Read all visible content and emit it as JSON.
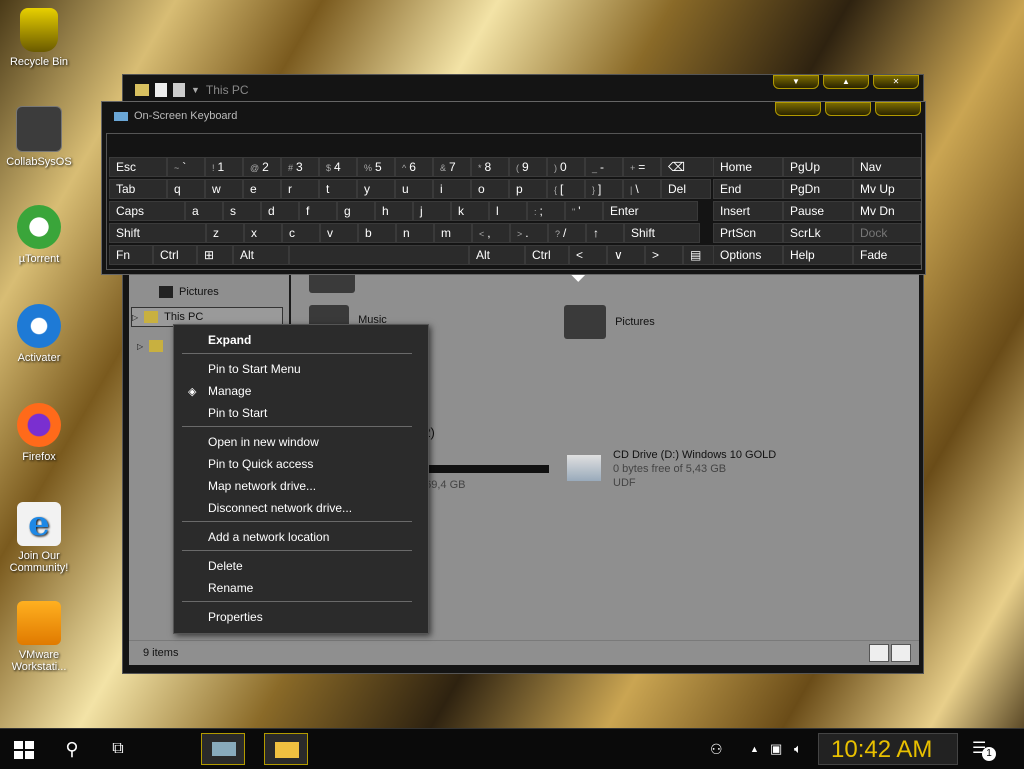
{
  "desktop": {
    "icons": [
      {
        "label": "Recycle Bin",
        "icon": "recycle-bin-icon"
      },
      {
        "label": "CollabSysOS",
        "icon": "folder-icon"
      },
      {
        "label": "µTorrent",
        "icon": "utorrent-icon"
      },
      {
        "label": "Activater",
        "icon": "activater-icon"
      },
      {
        "label": "Firefox",
        "icon": "firefox-icon"
      },
      {
        "label": "Join Our Community!",
        "icon": "ie-icon"
      },
      {
        "label": "VMware Workstati...",
        "icon": "vmware-icon"
      }
    ]
  },
  "explorer": {
    "title": "This PC",
    "nav": {
      "pictures": "Pictures",
      "this_pc": "This PC"
    },
    "items": {
      "music": "Music",
      "pictures": "Pictures",
      "devices_header": "(2)",
      "disk_free": "f 69,4 GB",
      "cd_drive_name": "CD Drive (D:) Windows 10 GOLD",
      "cd_drive_free": "0 bytes free of 5,43 GB",
      "cd_drive_fs": "UDF"
    },
    "status": "9 items"
  },
  "osk": {
    "title": "On-Screen Keyboard",
    "rows": [
      [
        [
          "Esc",
          ""
        ],
        [
          "`",
          "~"
        ],
        [
          "1",
          "!"
        ],
        [
          "2",
          "@"
        ],
        [
          "3",
          "#"
        ],
        [
          "4",
          "$"
        ],
        [
          "5",
          "%"
        ],
        [
          "6",
          "^"
        ],
        [
          "7",
          "&"
        ],
        [
          "8",
          "*"
        ],
        [
          "9",
          "("
        ],
        [
          "0",
          ")"
        ],
        [
          "-",
          "_"
        ],
        [
          "=",
          "+"
        ],
        [
          "⌫",
          ""
        ]
      ],
      [
        [
          "Tab",
          ""
        ],
        [
          "q",
          ""
        ],
        [
          "w",
          ""
        ],
        [
          "e",
          ""
        ],
        [
          "r",
          ""
        ],
        [
          "t",
          ""
        ],
        [
          "y",
          ""
        ],
        [
          "u",
          ""
        ],
        [
          "i",
          ""
        ],
        [
          "o",
          ""
        ],
        [
          "p",
          ""
        ],
        [
          "[",
          "{"
        ],
        [
          "]",
          "}"
        ],
        [
          "\\",
          "|"
        ],
        [
          "Del",
          ""
        ]
      ],
      [
        [
          "Caps",
          ""
        ],
        [
          "a",
          ""
        ],
        [
          "s",
          ""
        ],
        [
          "d",
          ""
        ],
        [
          "f",
          ""
        ],
        [
          "g",
          ""
        ],
        [
          "h",
          ""
        ],
        [
          "j",
          ""
        ],
        [
          "k",
          ""
        ],
        [
          "l",
          ""
        ],
        [
          ";",
          ":"
        ],
        [
          "'",
          "\""
        ],
        [
          "Enter",
          ""
        ]
      ],
      [
        [
          "Shift",
          ""
        ],
        [
          "z",
          ""
        ],
        [
          "x",
          ""
        ],
        [
          "c",
          ""
        ],
        [
          "v",
          ""
        ],
        [
          "b",
          ""
        ],
        [
          "n",
          ""
        ],
        [
          "m",
          ""
        ],
        [
          ",",
          "<"
        ],
        [
          ".",
          ">"
        ],
        [
          "/",
          "?"
        ],
        [
          "↑",
          ""
        ],
        [
          "Shift",
          ""
        ]
      ],
      [
        [
          "Fn",
          ""
        ],
        [
          "Ctrl",
          ""
        ],
        [
          "⊞",
          ""
        ],
        [
          "Alt",
          ""
        ],
        [
          "",
          ""
        ],
        [
          "Alt",
          ""
        ],
        [
          "Ctrl",
          ""
        ],
        [
          "<",
          ""
        ],
        [
          "∨",
          ""
        ],
        [
          ">",
          ""
        ],
        [
          "▤",
          ""
        ]
      ]
    ],
    "side": [
      [
        "Home",
        "PgUp",
        "Nav"
      ],
      [
        "End",
        "PgDn",
        "Mv Up"
      ],
      [
        "Insert",
        "Pause",
        "Mv Dn"
      ],
      [
        "PrtScn",
        "ScrLk",
        "Dock"
      ],
      [
        "Options",
        "Help",
        "Fade"
      ]
    ]
  },
  "context_menu": {
    "items": [
      "Expand",
      "Pin to Start Menu",
      "Manage",
      "Pin to Start",
      "Open in new window",
      "Pin to Quick access",
      "Map network drive...",
      "Disconnect network drive...",
      "Add a network location",
      "Delete",
      "Rename",
      "Properties"
    ]
  },
  "taskbar": {
    "clock": "10:42 AM",
    "notification_count": "1"
  },
  "colors": {
    "accent_gold": "#e8c000",
    "menu_bg": "#2b2b2b"
  }
}
